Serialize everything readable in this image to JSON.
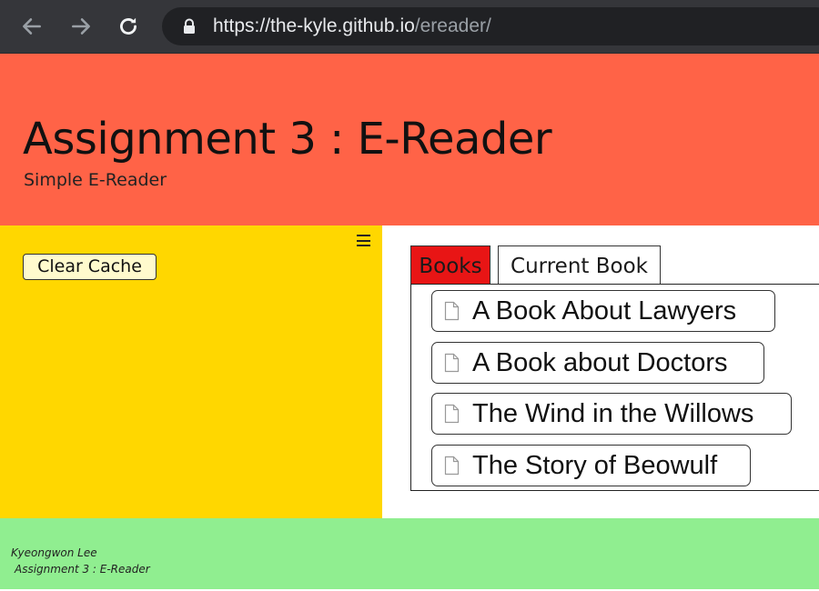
{
  "browser": {
    "url_host": "https://the-kyle.github.io",
    "url_path": "/ereader/"
  },
  "header": {
    "title": "Assignment 3 : E-Reader",
    "subtitle": "Simple E-Reader"
  },
  "sidebar": {
    "menu_icon": "hamburger-icon",
    "clear_cache_label": "Clear Cache"
  },
  "tabs": [
    {
      "label": "Books",
      "active": true
    },
    {
      "label": "Current Book",
      "active": false
    }
  ],
  "books": [
    {
      "title": "A Book About Lawyers",
      "icon": "document-icon"
    },
    {
      "title": "A Book about Doctors",
      "icon": "document-icon"
    },
    {
      "title": "The Wind in the Willows",
      "icon": "document-icon"
    },
    {
      "title": "The Story of Beowulf",
      "icon": "document-icon"
    }
  ],
  "footer": {
    "author": "Kyeongwon Lee",
    "course": "Assignment 3 : E-Reader"
  },
  "colors": {
    "header_bg": "#ff6347",
    "sidebar_bg": "#ffd700",
    "footer_bg": "#90ee90",
    "active_tab_bg": "#e81515",
    "button_bg": "#fffacd"
  }
}
